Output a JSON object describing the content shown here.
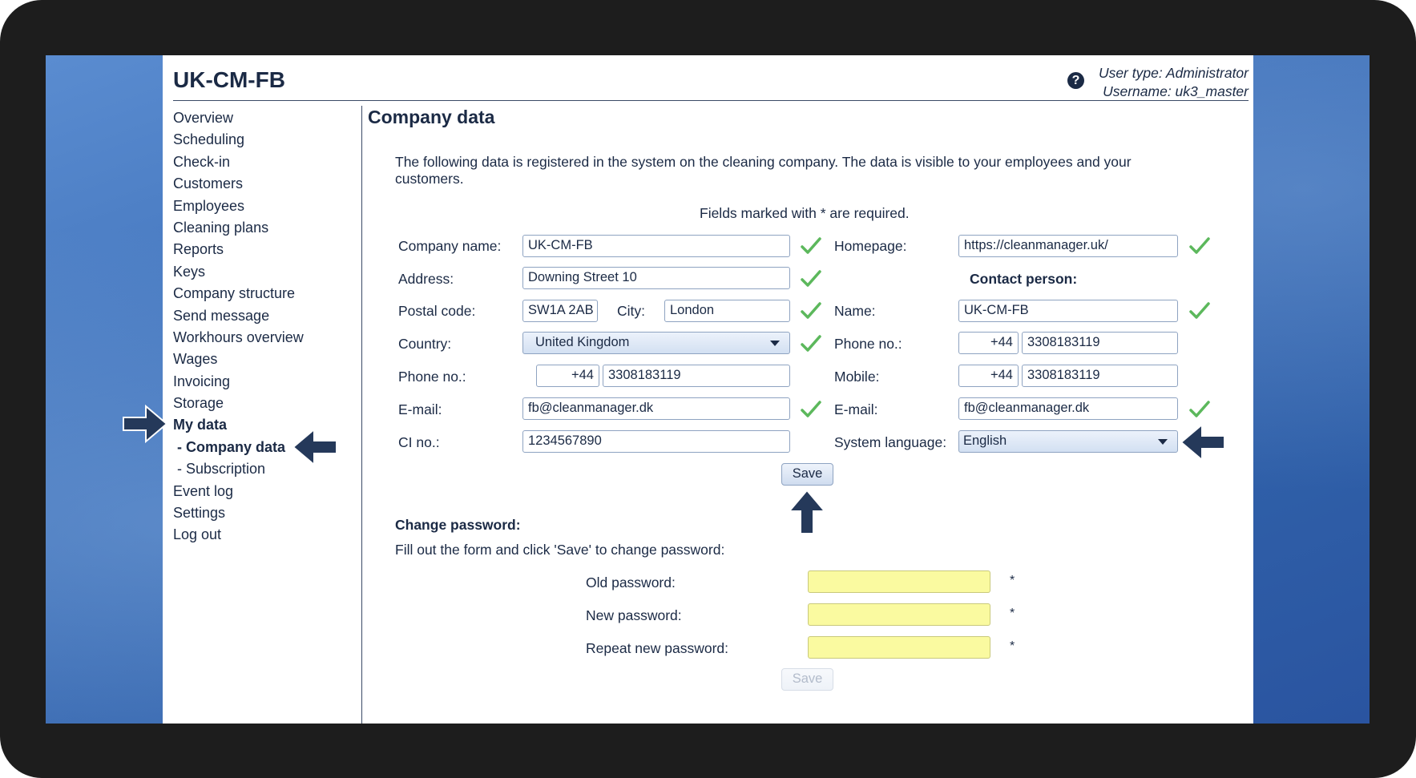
{
  "app": {
    "title": "UK-CM-FB",
    "user_type": "User type: Administrator",
    "username": "Username: uk3_master"
  },
  "nav": {
    "items": [
      {
        "label": "Overview"
      },
      {
        "label": "Scheduling"
      },
      {
        "label": "Check-in"
      },
      {
        "label": "Customers"
      },
      {
        "label": "Employees"
      },
      {
        "label": "Cleaning plans"
      },
      {
        "label": "Reports"
      },
      {
        "label": "Keys"
      },
      {
        "label": "Company structure"
      },
      {
        "label": "Send message"
      },
      {
        "label": "Workhours overview"
      },
      {
        "label": "Wages"
      },
      {
        "label": "Invoicing"
      },
      {
        "label": "Storage"
      },
      {
        "label": "My data",
        "active": true
      },
      {
        "label": "- Company data",
        "active": true
      },
      {
        "label": "- Subscription"
      },
      {
        "label": "Event log"
      },
      {
        "label": "Settings"
      },
      {
        "label": "Log out"
      }
    ]
  },
  "page": {
    "title": "Company data",
    "intro": "The following data is registered in the system on the cleaning company. The data is visible to your employees and your customers.",
    "required_note": "Fields marked with * are required."
  },
  "company": {
    "name_label": "Company name:",
    "name_value": "UK-CM-FB",
    "address_label": "Address:",
    "address_value": "Downing Street 10",
    "postal_label": "Postal code:",
    "postal_value": "SW1A 2AB",
    "city_label": "City:",
    "city_value": "London",
    "country_label": "Country:",
    "country_value": "United Kingdom",
    "phone_label": "Phone no.:",
    "phone_prefix": "+44",
    "phone_value": "3308183119",
    "email_label": "E-mail:",
    "email_value": "fb@cleanmanager.dk",
    "ci_label": "CI no.:",
    "ci_value": "1234567890",
    "homepage_label": "Homepage:",
    "homepage_value": "https://cleanmanager.uk/"
  },
  "contact": {
    "heading": "Contact person:",
    "name_label": "Name:",
    "name_value": "UK-CM-FB",
    "phone_label": "Phone no.:",
    "phone_prefix": "+44",
    "phone_value": "3308183119",
    "mobile_label": "Mobile:",
    "mobile_prefix": "+44",
    "mobile_value": "3308183119",
    "email_label": "E-mail:",
    "email_value": "fb@cleanmanager.dk",
    "language_label": "System language:",
    "language_value": "English"
  },
  "save_label": "Save",
  "password": {
    "heading": "Change password:",
    "instruction": "Fill out the form and click 'Save' to change password:",
    "old_label": "Old password:",
    "new_label": "New password:",
    "repeat_label": "Repeat new password:",
    "required_mark": "*",
    "save_label": "Save"
  },
  "colors": {
    "frame": "#1d1d1d",
    "text": "#1b2a45",
    "check": "#5cb85c",
    "arrow": "#25395a",
    "password_field": "#fafaa0"
  }
}
